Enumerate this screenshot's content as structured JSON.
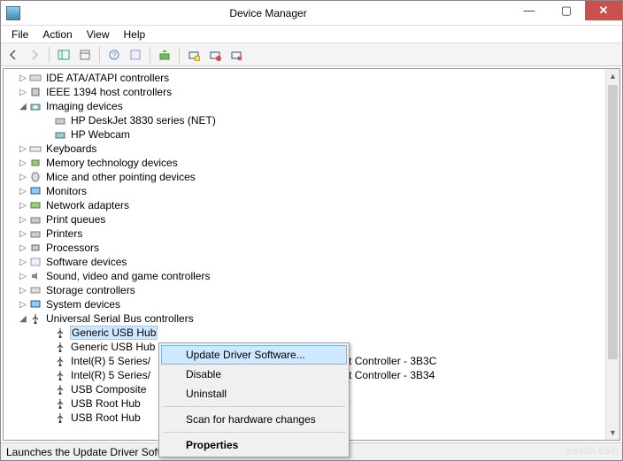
{
  "window": {
    "title": "Device Manager"
  },
  "menus": {
    "file": "File",
    "action": "Action",
    "view": "View",
    "help": "Help"
  },
  "tree": {
    "ide": "IDE ATA/ATAPI controllers",
    "ieee1394": "IEEE 1394 host controllers",
    "imaging": "Imaging devices",
    "hp3830": "HP DeskJet 3830 series (NET)",
    "hpwebcam": "HP Webcam",
    "keyboards": "Keyboards",
    "memtech": "Memory technology devices",
    "mice": "Mice and other pointing devices",
    "monitors": "Monitors",
    "netadapters": "Network adapters",
    "printqueues": "Print queues",
    "printers": "Printers",
    "processors": "Processors",
    "software": "Software devices",
    "sound": "Sound, video and game controllers",
    "storage": "Storage controllers",
    "sysdevices": "System devices",
    "usb": "Universal Serial Bus controllers",
    "genhub1": "Generic USB Hub",
    "genhub2": "Generic USB Hub",
    "intel1_trunc": "Intel(R) 5 Series/",
    "intel1_tail": "st Controller - 3B3C",
    "intel2_trunc": "Intel(R) 5 Series/",
    "intel2_tail": "st Controller - 3B34",
    "usbcomposite": "USB Composite",
    "usbroot1": "USB Root Hub",
    "usbroot2": "USB Root Hub"
  },
  "context_menu": {
    "update": "Update Driver Software...",
    "disable": "Disable",
    "uninstall": "Uninstall",
    "scan": "Scan for hardware changes",
    "properties": "Properties"
  },
  "status": "Launches the Update Driver Software Wizard for the selected device.",
  "watermark": "wsxdn.com"
}
